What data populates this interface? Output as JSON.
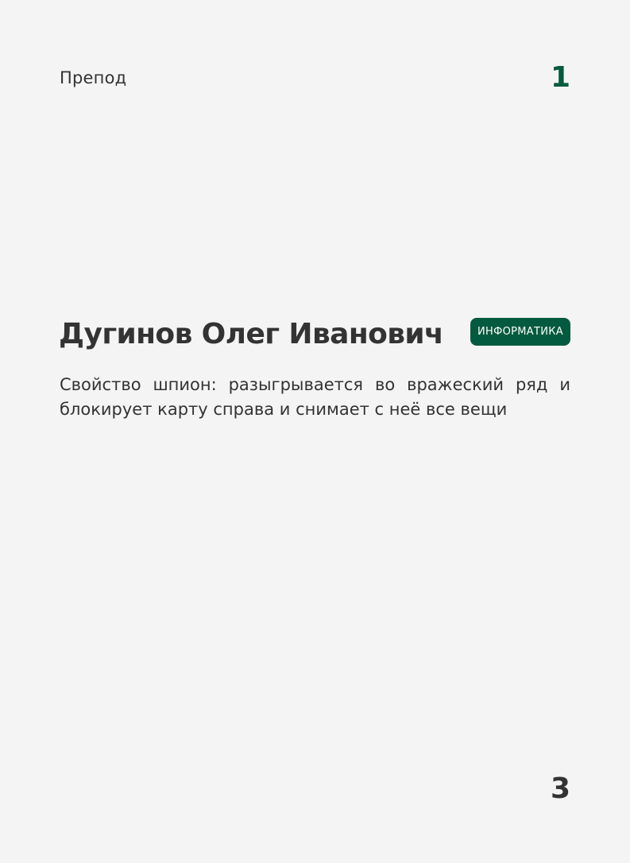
{
  "card": {
    "type_label": "Препод",
    "top_number": "1",
    "name": "Дугинов Олег Иванович",
    "subject_badge": "ИНФОРМАТИКА",
    "description": "Свойство шпион: разыгрывается во вражеский ряд и блокирует карту справа и снимает с неё все вещи",
    "bottom_number": "3"
  },
  "colors": {
    "background": "#f4f4f4",
    "accent": "#045a3e",
    "text": "#333333",
    "badge_text": "#ffffff"
  }
}
